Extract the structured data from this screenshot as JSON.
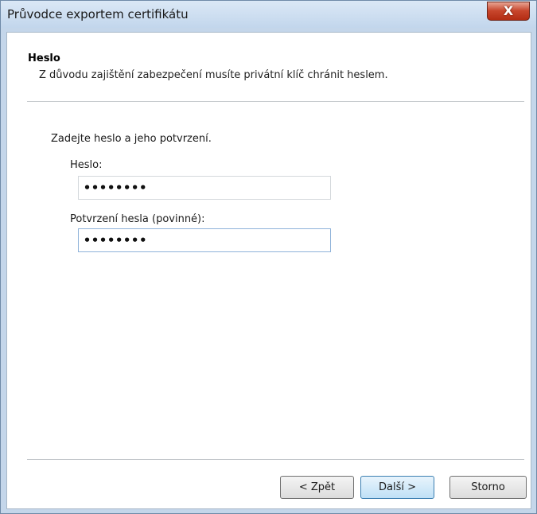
{
  "window": {
    "title": "Průvodce exportem certifikátu",
    "close_glyph": "X"
  },
  "header": {
    "title": "Heslo",
    "description": "Z důvodu zajištění zabezpečení musíte privátní klíč chránit heslem."
  },
  "form": {
    "prompt": "Zadejte heslo a jeho potvrzení.",
    "password_label": "Heslo:",
    "password_value": "••••••••",
    "confirm_label": "Potvrzení hesla (povinné):",
    "confirm_value": "••••••••"
  },
  "buttons": {
    "back": "< Zpět",
    "next": "Další >",
    "cancel": "Storno"
  },
  "colors": {
    "close_button": "#c7462c",
    "title_bar": "#c2d6ec",
    "default_button": "#bfe0f6"
  }
}
